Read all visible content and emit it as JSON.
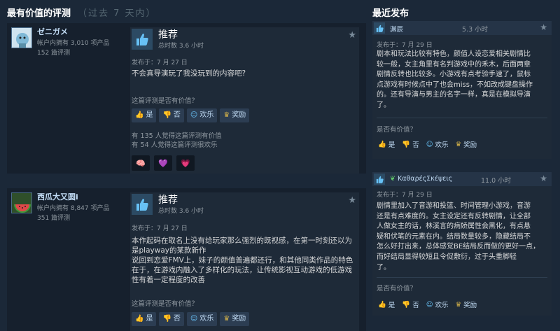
{
  "left_heading": {
    "title": "最有价值的评测",
    "subtitle": "（过去 7 天内）"
  },
  "right_heading": {
    "title": "最近发布"
  },
  "reviews": [
    {
      "author": "ゼニガメ",
      "products": "帐户内拥有 3,010 项产品",
      "reviews_count": "152 篇评测",
      "recommendation": "推荐",
      "hours": "总时数 3.6 小时",
      "posted": "发布于：7 月 27 日",
      "content": [
        "不会真导演玩了我没玩到的内容吧?"
      ],
      "helpful_question": "这篇评测是否有价值？",
      "votes": {
        "yes": "是",
        "no": "否",
        "funny": "欢乐",
        "award": "奖励"
      },
      "helpful_stat": "有 135 人觉得这篇评测有价值",
      "funny_stat": "有 54 人觉得这篇评测很欢乐",
      "reactions": [
        "🧠",
        "💜",
        "💗"
      ]
    },
    {
      "author": "西瓜大又圆i",
      "products": "帐户内拥有 8,847 项产品",
      "reviews_count": "351 篇评测",
      "recommendation": "推荐",
      "hours": "总时数 3.6 小时",
      "posted": "发布于：7 月 27 日",
      "content": [
        "本作起码在取名上没有给玩家那么强烈的既视感，在第一时刻还以为",
        "是playway的某款新作",
        "说回到恋爱FMV上，妹子的颜值普遍都还行，和其他同类作品的特色",
        "在于，在游戏内融入了多样化的玩法，让传统影视互动游戏的低游戏",
        "性有着一定程度的改善"
      ],
      "helpful_question": "这篇评测是否有价值？",
      "votes": {
        "yes": "是",
        "no": "否",
        "funny": "欢乐",
        "award": "奖励"
      }
    }
  ],
  "recent": [
    {
      "author": "渊辰",
      "hours": "5.3 小时",
      "posted": "发布于：7 月 29 日",
      "content": [
        "剧本和玩法比较有特色，颜值人设恋爱相关剧情比",
        "较一般，女主角里有名判游戏中的禾木，后面两章",
        "剧情反转也比较多。小游戏有点考验手速了，鼠标",
        "点游戏有时候点中了也会miss，不如改成键盘操作",
        "的。还有导演与男主的名字一样，真是在模拟导演",
        "了。"
      ],
      "helpful_question": "是否有价值？",
      "votes": {
        "yes": "是",
        "no": "否",
        "funny": "欢乐",
        "award": "奖励"
      }
    },
    {
      "author": "ΚαθαρέςΣκέψεις",
      "hours": "11.0 小时",
      "posted": "发布于：7 月 29 日",
      "content": [
        "剧情里加入了音游和投篮、时间管理小游戏，音游",
        "还是有点难度的。女主设定还有反转剧情，让全部",
        "人做女主的话，林溪言的病娇属性会黑化，有点悬",
        "疑和伏笔的元素在内。结局数量较多，隐藏结局不",
        "怎么好打出来，总体感觉BE结局反而做的更好一点，",
        "而好结局显得较短且令促敷衍，过于头重脚轻",
        "了。"
      ],
      "helpful_question": "是否有价值？",
      "votes": {
        "yes": "是",
        "no": "否",
        "funny": "欢乐",
        "award": "奖励"
      }
    }
  ]
}
